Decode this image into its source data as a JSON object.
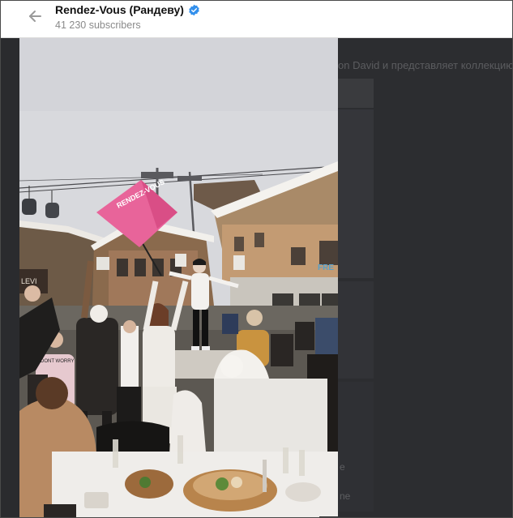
{
  "header": {
    "back_icon": "arrow-left-icon",
    "channel_name": "Rendez-Vous (Рандеву)",
    "verified_icon": "verified-badge-icon",
    "subscribers": "41 230 subscribers"
  },
  "background_chat": {
    "message_fragment": "on David и представляет коллекцию",
    "side_fragments": [
      "e",
      "ne"
    ]
  },
  "photo": {
    "flag_text": "RENDEZ-VOUS",
    "shirt_text": "DONT WORRY",
    "sign_text": "FRE",
    "store_sign": "LEVI"
  },
  "colors": {
    "header_bg": "#ffffff",
    "verified": "#3390ec",
    "flag_pink": "#e85b8f",
    "overlay_dark": "#2b2c2f"
  }
}
